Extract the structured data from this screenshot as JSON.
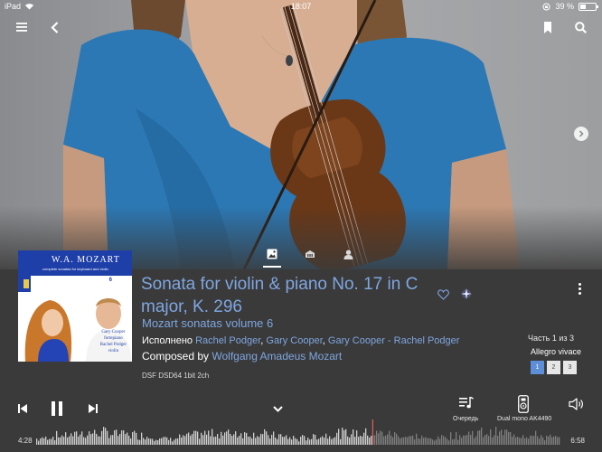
{
  "status": {
    "device": "iPad",
    "time": "18:07",
    "battery": "39 %"
  },
  "icons": {
    "menu": "hamburger-menu-icon",
    "back": "chevron-left-icon",
    "bookmark": "bookmark-icon",
    "search": "search-icon",
    "next_image": "chevron-right-icon",
    "tabs": [
      "image-tab-icon",
      "artist-info-tab-icon",
      "person-tab-icon"
    ]
  },
  "cover": {
    "title": "W.A. MOZART",
    "subtitle": "complete sonatas for keyboard and violin",
    "volume": "6",
    "caption_line1": "Gary Cooper",
    "caption_line2": "fortepiano",
    "caption_line3": "Rachel Podger",
    "caption_line4": "violin"
  },
  "track": {
    "title": "Sonata for violin & piano No. 17 in C major, K. 296",
    "album": "Mozart sonatas volume 6",
    "performed_prefix": "Исполнено",
    "performers": [
      "Rachel Podger",
      "Gary Cooper",
      "Gary Cooper - Rachel Podger"
    ],
    "composed_prefix": "Composed by",
    "composer": "Wolfgang Amadeus Mozart",
    "format": "DSF DSD64 1bit 2ch"
  },
  "parts": {
    "label": "Часть 1 из 3",
    "movement": "Allegro vivace",
    "pages": [
      "1",
      "2",
      "3"
    ],
    "active": "1"
  },
  "player": {
    "queue_label": "Очередь",
    "output_label": "Dual mono AK4490",
    "elapsed": "4:28",
    "total": "6:58",
    "progress_fraction": 0.641
  },
  "colors": {
    "accent": "#7fa6e0",
    "page_active": "#5d8fd8",
    "background": "#3a3a3a"
  }
}
